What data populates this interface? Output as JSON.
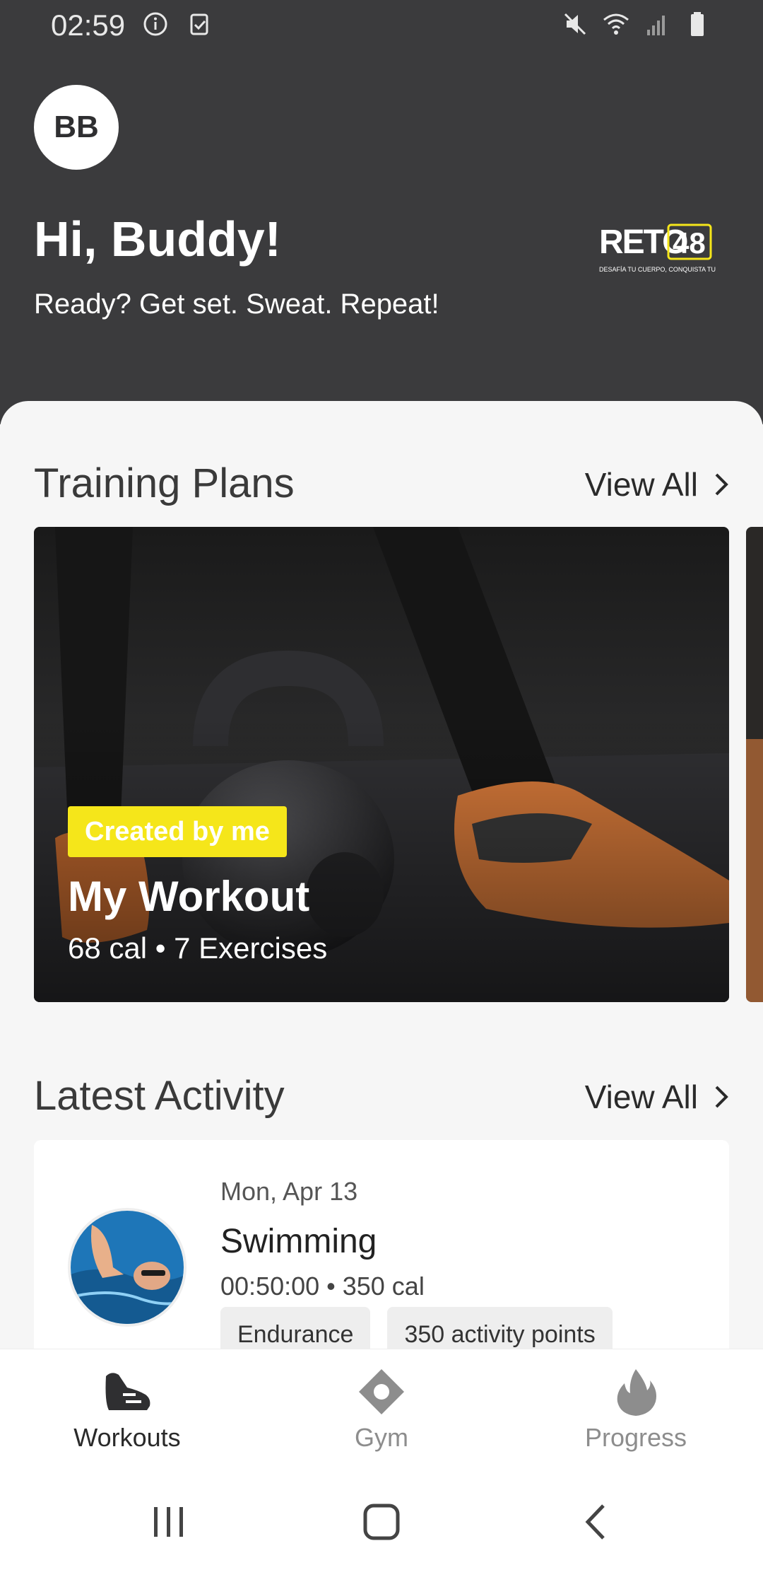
{
  "status_bar": {
    "time": "02:59",
    "left_icons": [
      "info-icon",
      "clipboard-check-icon"
    ],
    "right_icons": [
      "mute-icon",
      "wifi-icon",
      "signal-icon",
      "battery-icon"
    ]
  },
  "header": {
    "avatar_initials": "BB",
    "greeting": "Hi, Buddy!",
    "subtitle": "Ready? Get set. Sweat. Repeat!",
    "logo": {
      "text": "RETO",
      "number": "48",
      "tagline": "DESAFÍA TU CUERPO, CONQUISTA TU MENTE"
    }
  },
  "training_plans": {
    "title": "Training Plans",
    "view_all": "View All",
    "card": {
      "badge": "Created by me",
      "title": "My Workout",
      "meta": "68 cal • 7 Exercises"
    }
  },
  "latest_activity": {
    "title": "Latest Activity",
    "view_all": "View All",
    "item": {
      "date": "Mon, Apr 13",
      "title": "Swimming",
      "meta": "00:50:00 • 350 cal",
      "chips": [
        "Endurance",
        "350 activity points"
      ]
    }
  },
  "bottom_nav": {
    "items": [
      {
        "label": "Workouts",
        "icon": "shoe-icon",
        "active": true
      },
      {
        "label": "Gym",
        "icon": "location-pin-icon",
        "active": false
      },
      {
        "label": "Progress",
        "icon": "flame-icon",
        "active": false
      }
    ]
  },
  "system_nav": [
    "recent-apps-icon",
    "home-icon",
    "back-icon"
  ],
  "colors": {
    "header_bg": "#3b3b3d",
    "badge_yellow": "#f5e61a",
    "page_bg": "#f6f6f6"
  }
}
